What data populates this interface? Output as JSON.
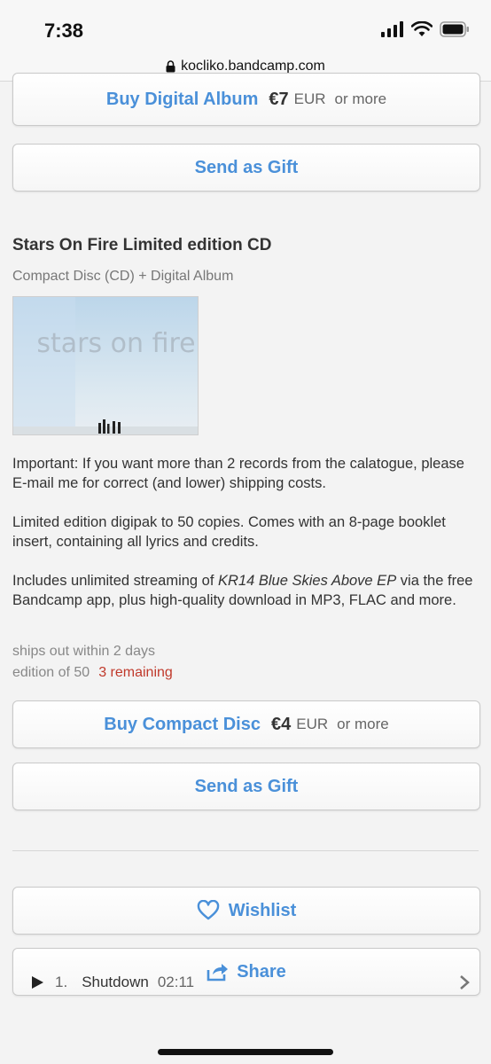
{
  "status": {
    "time": "7:38"
  },
  "browser": {
    "url": "kocliko.bandcamp.com"
  },
  "digital": {
    "buy_label": "Buy Digital Album",
    "price": "€7",
    "currency": "EUR",
    "or_more": "or more",
    "gift_label": "Send as Gift"
  },
  "cd": {
    "title": "Stars On Fire Limited edition CD",
    "format": "Compact Disc (CD) + Digital Album",
    "cover_text": "stars on fire",
    "desc_important": "Important: If you want more than 2 records from the calatogue, please E-mail me for correct (and lower) shipping costs.",
    "desc_limited": "Limited edition digipak to 50 copies. Comes with an 8-page booklet insert, containing all lyrics and credits.",
    "desc_includes_pre": "Includes unlimited streaming of ",
    "desc_includes_em": "KR14 Blue Skies Above EP",
    "desc_includes_post": " via the free Bandcamp app, plus high-quality download in MP3, FLAC and more.",
    "ships": "ships out within 2 days",
    "edition": "edition of 50",
    "remaining": "3 remaining",
    "buy_label": "Buy Compact Disc",
    "price": "€4",
    "currency": "EUR",
    "or_more": "or more",
    "gift_label": "Send as Gift"
  },
  "actions": {
    "wishlist": "Wishlist",
    "share": "Share"
  },
  "track": {
    "number": "1.",
    "title": "Shutdown",
    "duration": "02:11"
  },
  "colors": {
    "link": "#4a90d9",
    "remaining": "#c0392b"
  }
}
